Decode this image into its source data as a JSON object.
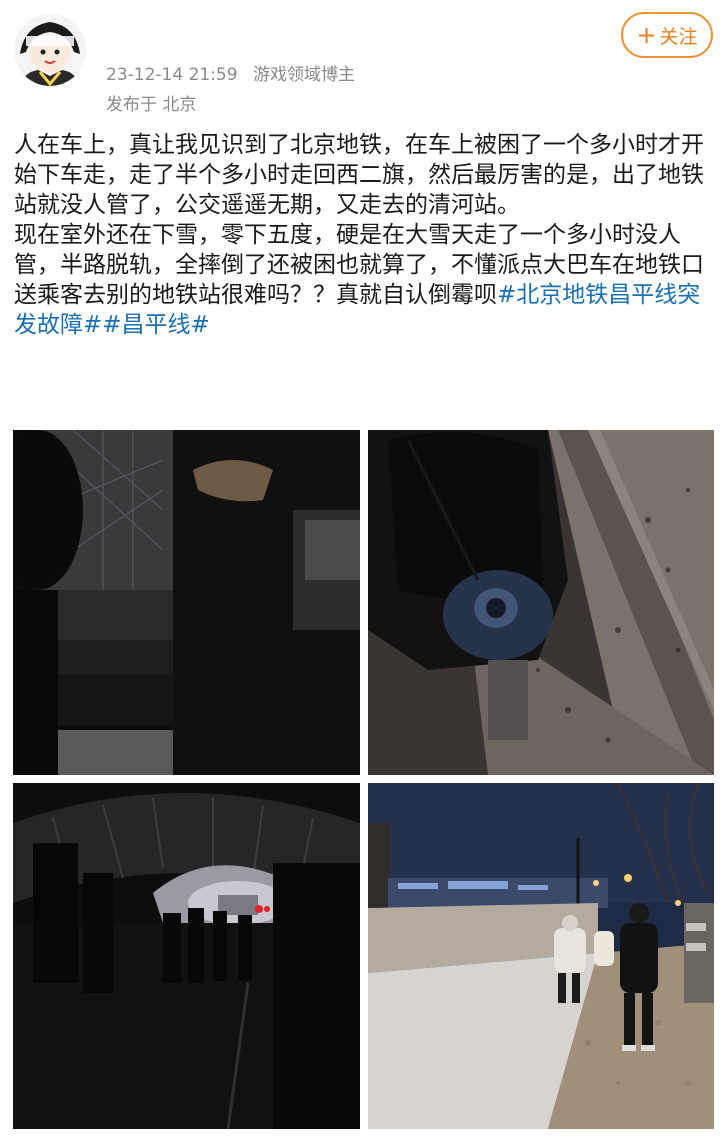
{
  "post": {
    "timestamp": "23-12-14 21:59",
    "author_role": "游戏领域博主",
    "location": "发布于 北京",
    "follow_label": "关注",
    "paragraph1": "人在车上，真让我见识到了北京地铁，在车上被困了一个多小时才开始下车走，走了半个多小时走回西二旗，然后最厉害的是，出了地铁站就没人管了，公交遥遥无期，又走去的清河站。",
    "paragraph2": "现在室外还在下雪，零下五度，硬是在大雪天走了一个多小时没人管，半路脱轨，全摔倒了还被困也就算了，不懂派点大巴车在地铁口送乘客去别的地铁站很难吗？？真就自认倒霉呗",
    "hashtags": [
      "#北京地铁昌平线突发故障#",
      "#昌平线#"
    ]
  },
  "colors": {
    "accent": "#f07d1a",
    "link": "#1a6fb5",
    "meta_gray": "#8a8a8a"
  },
  "icons": {
    "follow": "plus-icon"
  }
}
